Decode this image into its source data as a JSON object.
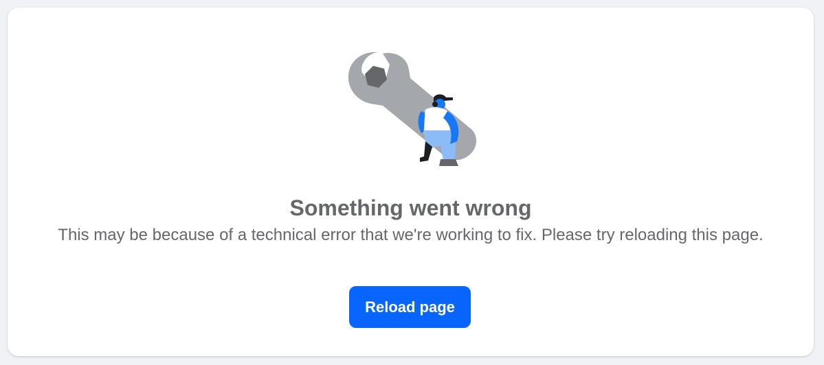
{
  "error": {
    "title": "Something went wrong",
    "message": "This may be because of a technical error that we're working to fix. Please try reloading this page.",
    "reload_label": "Reload page",
    "illustration_icon": "wrench-worker-illustration"
  },
  "colors": {
    "background": "#f0f2f5",
    "card": "#ffffff",
    "text_secondary": "#65676b",
    "primary_button": "#0866ff",
    "wrench_gray": "#a4a7ab",
    "nut_gray": "#65676b",
    "figure_blue": "#1877f2",
    "figure_light_blue": "#8bbcf7"
  }
}
